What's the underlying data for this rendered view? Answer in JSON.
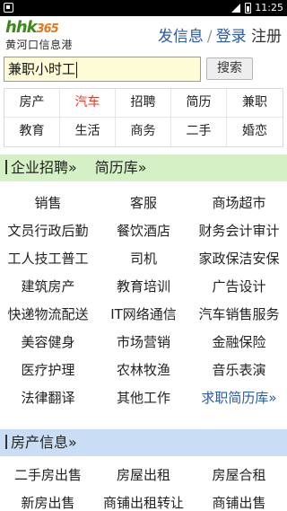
{
  "status_bar": {
    "time": "11:25",
    "icons": [
      "app-notification-icon",
      "signal-icon",
      "battery-icon"
    ]
  },
  "header": {
    "logo_mark": "hhk",
    "logo_number": "365",
    "logo_subtitle": "黄河口信息港",
    "post_link": "发信息",
    "separator": "/",
    "login_link": "登录",
    "register_link": "注册"
  },
  "search": {
    "value": "兼职小时工",
    "button_label": "搜索"
  },
  "categories": [
    {
      "label": "房产",
      "highlight": false
    },
    {
      "label": "汽车",
      "highlight": true
    },
    {
      "label": "招聘",
      "highlight": false
    },
    {
      "label": "简历",
      "highlight": false
    },
    {
      "label": "兼职",
      "highlight": false
    },
    {
      "label": "教育",
      "highlight": false
    },
    {
      "label": "生活",
      "highlight": false
    },
    {
      "label": "商务",
      "highlight": false
    },
    {
      "label": "二手",
      "highlight": false
    },
    {
      "label": "婚恋",
      "highlight": false
    }
  ],
  "jobs_section": {
    "title": "企业招聘»",
    "secondary": "简历库»",
    "items": [
      "销售",
      "客服",
      "商场超市",
      "文员行政后勤",
      "餐饮酒店",
      "财务会计审计",
      "工人技工普工",
      "司机",
      "家政保洁安保",
      "建筑房产",
      "教育培训",
      "广告设计",
      "快递物流配送",
      "IT网络通信",
      "汽车销售服务",
      "美容健身",
      "市场营销",
      "金融保险",
      "医疗护理",
      "农林牧渔",
      "音乐表演",
      "法律翻译",
      "其他工作",
      "求职简历库»"
    ]
  },
  "house_section": {
    "title": "房产信息»",
    "items": [
      "二手房出售",
      "房屋出租",
      "房屋合租",
      "新房出售",
      "商铺出租转让",
      "商铺出售"
    ]
  },
  "colors": {
    "link_blue": "#2a59a8",
    "highlight_red": "#e33b2b",
    "jobs_bar_bg": "#d5f0c4",
    "house_bar_bg": "#c9ddf5",
    "search_bg": "#fdfcd6",
    "logo_green": "#3b8a19",
    "logo_orange": "#e4761b"
  }
}
